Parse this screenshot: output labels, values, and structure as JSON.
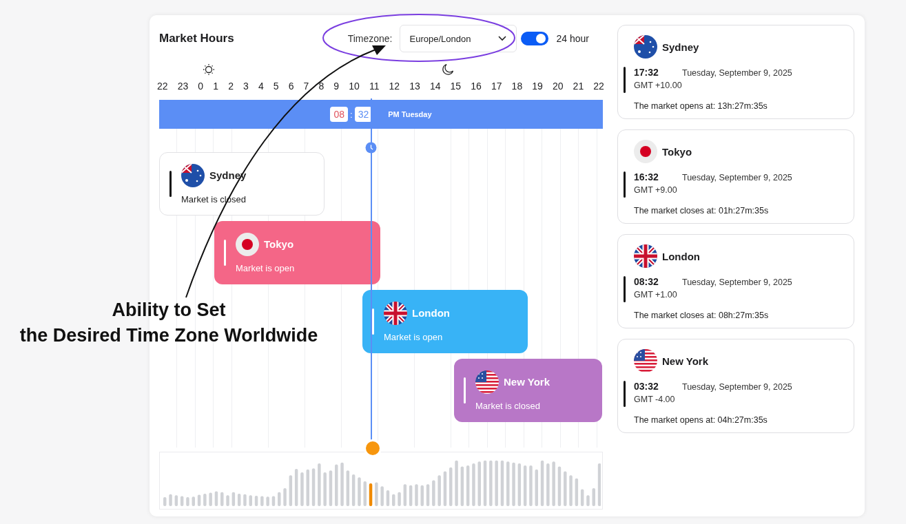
{
  "header": {
    "title": "Market Hours",
    "timezone_label": "Timezone:",
    "timezone_value": "Europe/London",
    "toggle": {
      "on": true,
      "label": "24 hour"
    }
  },
  "hours": [
    "22",
    "23",
    "0",
    "1",
    "2",
    "3",
    "4",
    "5",
    "6",
    "7",
    "8",
    "9",
    "10",
    "11",
    "12",
    "13",
    "14",
    "15",
    "16",
    "17",
    "18",
    "19",
    "20",
    "21",
    "22"
  ],
  "now_bar": {
    "hours": "08",
    "separator": ":",
    "minutes": "32",
    "suffix": "PM Tuesday"
  },
  "sessions": [
    {
      "name": "Sydney",
      "status": "Market is closed",
      "color": "#ffffff"
    },
    {
      "name": "Tokyo",
      "status": "Market is open",
      "color": "#f46687"
    },
    {
      "name": "London",
      "status": "Market is open",
      "color": "#38b3f6"
    },
    {
      "name": "New York",
      "status": "Market is closed",
      "color": "#b877c7"
    }
  ],
  "markets": [
    {
      "name": "Sydney",
      "time": "17:32",
      "date": "Tuesday, September 9, 2025",
      "gmt": "GMT +10.00",
      "countdown": "The market opens at: 13h:27m:35s"
    },
    {
      "name": "Tokyo",
      "time": "16:32",
      "date": "Tuesday, September 9, 2025",
      "gmt": "GMT +9.00",
      "countdown": "The market closes at: 01h:27m:35s"
    },
    {
      "name": "London",
      "time": "08:32",
      "date": "Tuesday, September 9, 2025",
      "gmt": "GMT +1.00",
      "countdown": "The market closes at: 08h:27m:35s"
    },
    {
      "name": "New York",
      "time": "03:32",
      "date": "Tuesday, September 9, 2025",
      "gmt": "GMT -4.00",
      "countdown": "The market opens at: 04h:27m:35s"
    }
  ],
  "annotation": {
    "lines": [
      "Ability to Set",
      "the Desired Time Zone Worldwide"
    ]
  }
}
